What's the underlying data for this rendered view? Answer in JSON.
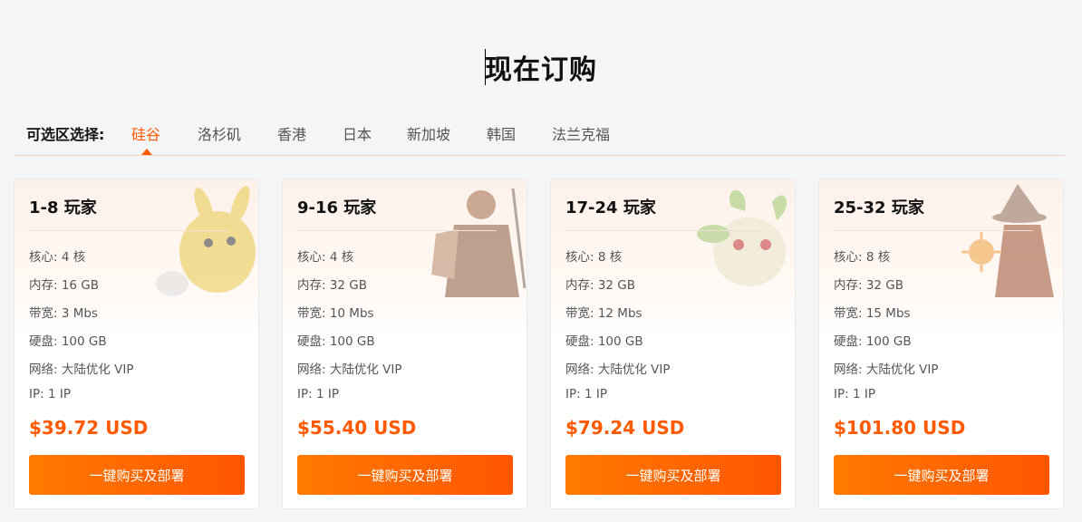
{
  "header": {
    "title": "现在订购"
  },
  "region": {
    "label": "可选区选择:",
    "tabs": [
      {
        "label": "硅谷",
        "active": true
      },
      {
        "label": "洛杉矶",
        "active": false
      },
      {
        "label": "香港",
        "active": false
      },
      {
        "label": "日本",
        "active": false
      },
      {
        "label": "新加坡",
        "active": false
      },
      {
        "label": "韩国",
        "active": false
      },
      {
        "label": "法兰克福",
        "active": false
      }
    ]
  },
  "colors": {
    "accent": "#ff5a00",
    "button_start": "#ff7a00",
    "button_end": "#ff5500"
  },
  "plans": [
    {
      "title": "1-8 玩家",
      "art_icon": "yellow-creature-art",
      "specs": [
        "核心: 4 核",
        "内存: 16 GB",
        "带宽: 3 Mbs",
        "硬盘: 100 GB",
        "网络: 大陆优化 VIP",
        "IP: 1 IP"
      ],
      "price": "$39.72 USD",
      "button": "一键购买及部署"
    },
    {
      "title": "9-16 玩家",
      "art_icon": "warrior-art",
      "specs": [
        "核心: 4 核",
        "内存: 32 GB",
        "带宽: 10 Mbs",
        "硬盘: 100 GB",
        "网络: 大陆优化 VIP",
        "IP: 1 IP"
      ],
      "price": "$55.40 USD",
      "button": "一键购买及部署"
    },
    {
      "title": "17-24 玩家",
      "art_icon": "green-creature-art",
      "specs": [
        "核心: 8 核",
        "内存: 32 GB",
        "带宽: 12 Mbs",
        "硬盘: 100 GB",
        "网络: 大陆优化 VIP",
        "IP: 1 IP"
      ],
      "price": "$79.24 USD",
      "button": "一键购买及部署"
    },
    {
      "title": "25-32 玩家",
      "art_icon": "witch-art",
      "specs": [
        "核心: 8 核",
        "内存: 32 GB",
        "带宽: 15 Mbs",
        "硬盘: 100 GB",
        "网络: 大陆优化 VIP",
        "IP: 1 IP"
      ],
      "price": "$101.80 USD",
      "button": "一键购买及部署"
    }
  ]
}
